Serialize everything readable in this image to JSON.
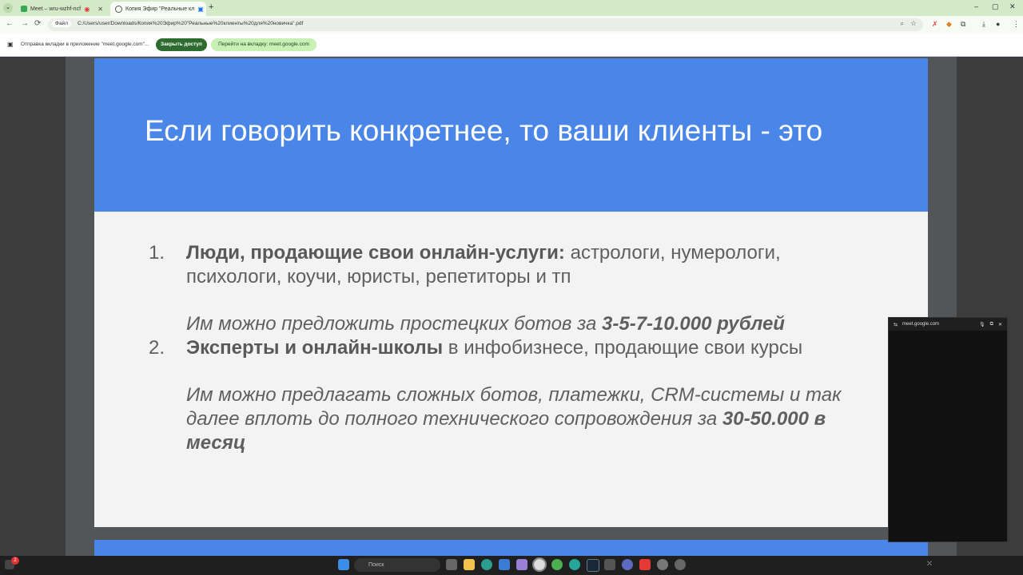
{
  "browser": {
    "tabs": [
      {
        "label": "Meet – wru-wzhf-ncf"
      },
      {
        "label": "Копия Эфир \"Реальные кл"
      }
    ],
    "nav": {
      "back": "←",
      "forward": "→",
      "reload": "⟳"
    },
    "omnibox": {
      "scheme_label": "Файл",
      "url": "C:/Users/user/Downloads/Копия%20Эфир%20\"Реальные%20клиенты%20для%20новичка\".pdf"
    },
    "share_bar": {
      "text": "Отправка вкладки в приложение \"meet.google.com\"...",
      "stop_button": "Закрыть доступ",
      "goto_button": "Перейти на вкладку: meet.google.com"
    }
  },
  "slide": {
    "title": "Если говорить конкретнее, то ваши клиенты - это",
    "items": [
      {
        "num": "1.",
        "bold": "Люди, продающие свои онлайн-услуги:",
        "rest": " астрологи, нумерологи, психологи, коучи, юристы, репетиторы и тп",
        "note_prefix": "Им можно предложить простецких ботов за ",
        "note_bold": "3-5-7-10.000 рублей"
      },
      {
        "num": "2.",
        "bold": "Эксперты и онлайн-школы",
        "rest": " в инфобизнесе, продающие свои курсы",
        "note_prefix": "Им можно предлагать сложных ботов, платежки, CRM-системы и так далее вплоть до полного технического сопровождения за ",
        "note_bold": "30-50.000 в месяц"
      }
    ]
  },
  "pip": {
    "url": "meet.google.com"
  },
  "taskbar": {
    "search_placeholder": "Поиск",
    "badge": "2"
  },
  "colors": {
    "slide_header": "#4a86e8",
    "tabbar": "#d3e9c8",
    "stop_button": "#2e6b2e"
  }
}
